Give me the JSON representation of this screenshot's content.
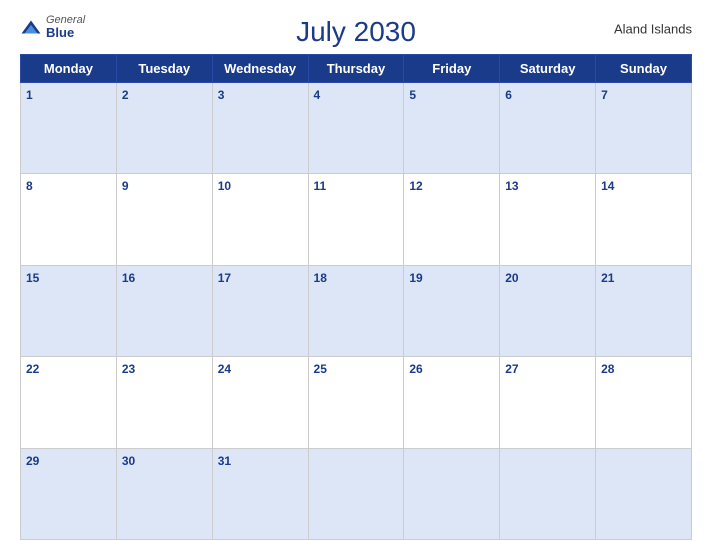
{
  "header": {
    "title": "July 2030",
    "region": "Aland Islands",
    "logo": {
      "general": "General",
      "blue": "Blue"
    }
  },
  "calendar": {
    "weekdays": [
      "Monday",
      "Tuesday",
      "Wednesday",
      "Thursday",
      "Friday",
      "Saturday",
      "Sunday"
    ],
    "weeks": [
      [
        1,
        2,
        3,
        4,
        5,
        6,
        7
      ],
      [
        8,
        9,
        10,
        11,
        12,
        13,
        14
      ],
      [
        15,
        16,
        17,
        18,
        19,
        20,
        21
      ],
      [
        22,
        23,
        24,
        25,
        26,
        27,
        28
      ],
      [
        29,
        30,
        31,
        null,
        null,
        null,
        null
      ]
    ]
  }
}
